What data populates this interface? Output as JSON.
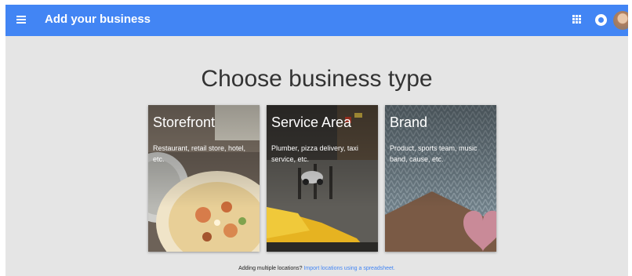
{
  "topbar": {
    "title": "Add your business",
    "menu_icon": "menu-icon",
    "apps_icon": "apps-grid-icon",
    "notifications_icon": "notifications-icon",
    "accent": "#4285f4"
  },
  "heading": "Choose business type",
  "cards": [
    {
      "title": "Storefront",
      "description": "Restaurant, retail store, hotel, etc."
    },
    {
      "title": "Service Area",
      "description": "Plumber, pizza delivery, taxi service, etc."
    },
    {
      "title": "Brand",
      "description": "Product, sports team, music band, cause, etc."
    }
  ],
  "footer": {
    "prefix": "Adding multiple locations?",
    "link": "Import locations using a spreadsheet."
  }
}
